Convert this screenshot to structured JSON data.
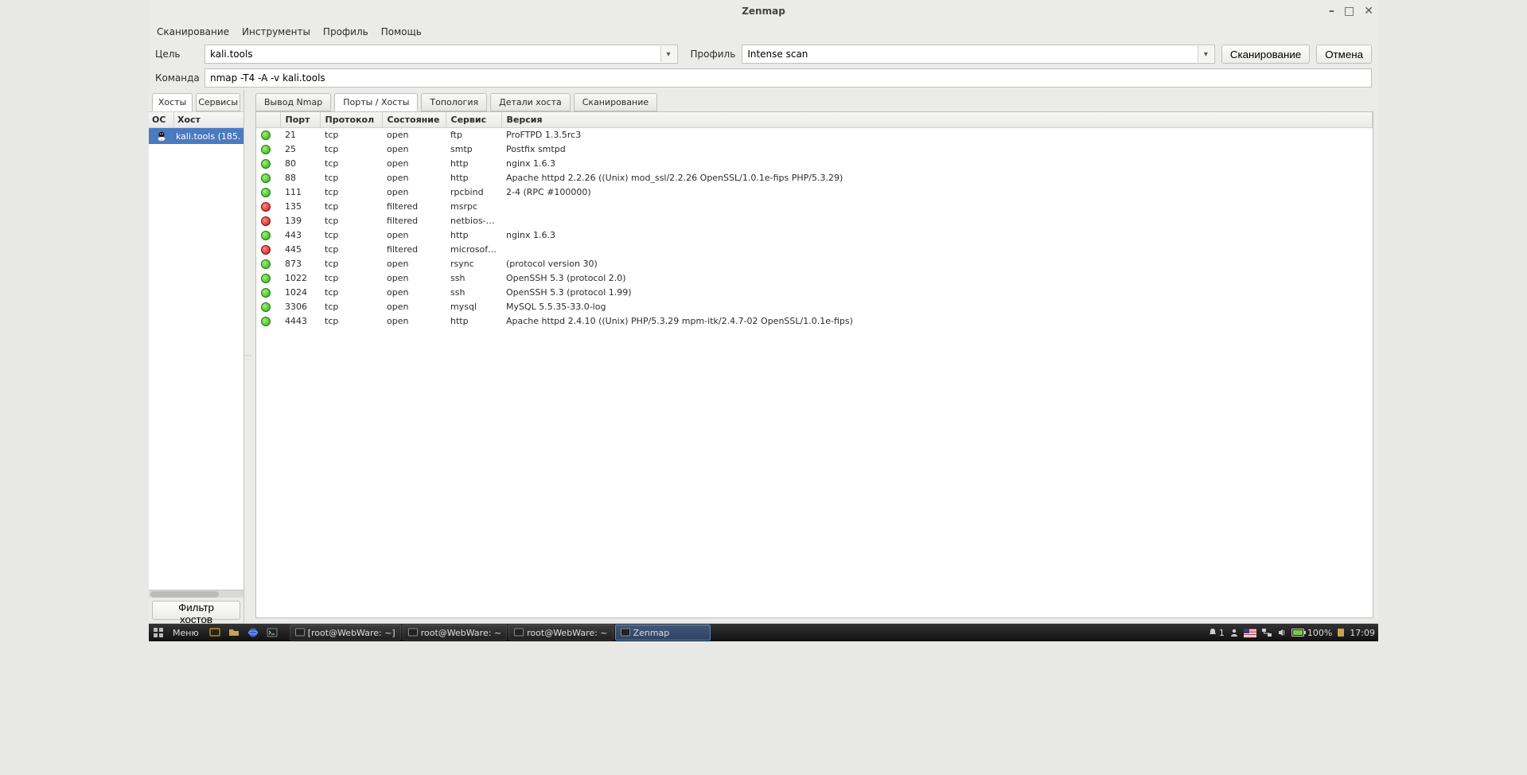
{
  "window": {
    "title": "Zenmap"
  },
  "menu": {
    "scan": "Сканирование",
    "tools": "Инструменты",
    "profile": "Профиль",
    "help": "Помощь"
  },
  "toolbar": {
    "target_label": "Цель",
    "target_value": "kali.tools",
    "profile_label": "Профиль",
    "profile_value": "Intense scan",
    "scan_button": "Сканирование",
    "cancel_button": "Отмена",
    "command_label": "Команда",
    "command_value": "nmap -T4 -A -v kali.tools"
  },
  "left_tabs": {
    "hosts": "Хосты",
    "services": "Сервисы"
  },
  "host_columns": {
    "os": "ОС",
    "host": "Хост"
  },
  "hosts": [
    {
      "name": "kali.tools (185."
    }
  ],
  "filter_button": "Фильтр хостов",
  "right_tabs": {
    "nmap_output": "Вывод Nmap",
    "ports_hosts": "Порты / Хосты",
    "topology": "Топология",
    "host_details": "Детали хоста",
    "scans": "Сканирование"
  },
  "port_columns": {
    "dot": "",
    "port": "Порт",
    "protocol": "Протокол",
    "state": "Состояние",
    "service": "Сервис",
    "version": "Версия"
  },
  "ports": [
    {
      "state": "open",
      "port": "21",
      "proto": "tcp",
      "state_label": "open",
      "service": "ftp",
      "version": "ProFTPD 1.3.5rc3"
    },
    {
      "state": "open",
      "port": "25",
      "proto": "tcp",
      "state_label": "open",
      "service": "smtp",
      "version": "Postfix smtpd"
    },
    {
      "state": "open",
      "port": "80",
      "proto": "tcp",
      "state_label": "open",
      "service": "http",
      "version": "nginx 1.6.3"
    },
    {
      "state": "open",
      "port": "88",
      "proto": "tcp",
      "state_label": "open",
      "service": "http",
      "version": "Apache httpd 2.2.26 ((Unix) mod_ssl/2.2.26 OpenSSL/1.0.1e-fips PHP/5.3.29)"
    },
    {
      "state": "open",
      "port": "111",
      "proto": "tcp",
      "state_label": "open",
      "service": "rpcbind",
      "version": "2-4 (RPC #100000)"
    },
    {
      "state": "filtered",
      "port": "135",
      "proto": "tcp",
      "state_label": "filtered",
      "service": "msrpc",
      "version": ""
    },
    {
      "state": "filtered",
      "port": "139",
      "proto": "tcp",
      "state_label": "filtered",
      "service": "netbios-ssn",
      "version": ""
    },
    {
      "state": "open",
      "port": "443",
      "proto": "tcp",
      "state_label": "open",
      "service": "http",
      "version": "nginx 1.6.3"
    },
    {
      "state": "filtered",
      "port": "445",
      "proto": "tcp",
      "state_label": "filtered",
      "service": "microsoft-ds",
      "version": ""
    },
    {
      "state": "open",
      "port": "873",
      "proto": "tcp",
      "state_label": "open",
      "service": "rsync",
      "version": "(protocol version 30)"
    },
    {
      "state": "open",
      "port": "1022",
      "proto": "tcp",
      "state_label": "open",
      "service": "ssh",
      "version": "OpenSSH 5.3 (protocol 2.0)"
    },
    {
      "state": "open",
      "port": "1024",
      "proto": "tcp",
      "state_label": "open",
      "service": "ssh",
      "version": "OpenSSH 5.3 (protocol 1.99)"
    },
    {
      "state": "open",
      "port": "3306",
      "proto": "tcp",
      "state_label": "open",
      "service": "mysql",
      "version": "MySQL 5.5.35-33.0-log"
    },
    {
      "state": "open",
      "port": "4443",
      "proto": "tcp",
      "state_label": "open",
      "service": "http",
      "version": "Apache httpd 2.4.10 ((Unix) PHP/5.3.29 mpm-itk/2.4.7-02 OpenSSL/1.0.1e-fips)"
    }
  ],
  "taskbar": {
    "menu": "Меню",
    "tasks": [
      {
        "label": "[root@WebWare: ~]",
        "active": false
      },
      {
        "label": "root@WebWare: ~",
        "active": false
      },
      {
        "label": "root@WebWare: ~",
        "active": false
      },
      {
        "label": "Zenmap",
        "active": true
      }
    ],
    "tray": {
      "notif_count": "1",
      "battery": "100%",
      "clock": "17:09"
    }
  }
}
